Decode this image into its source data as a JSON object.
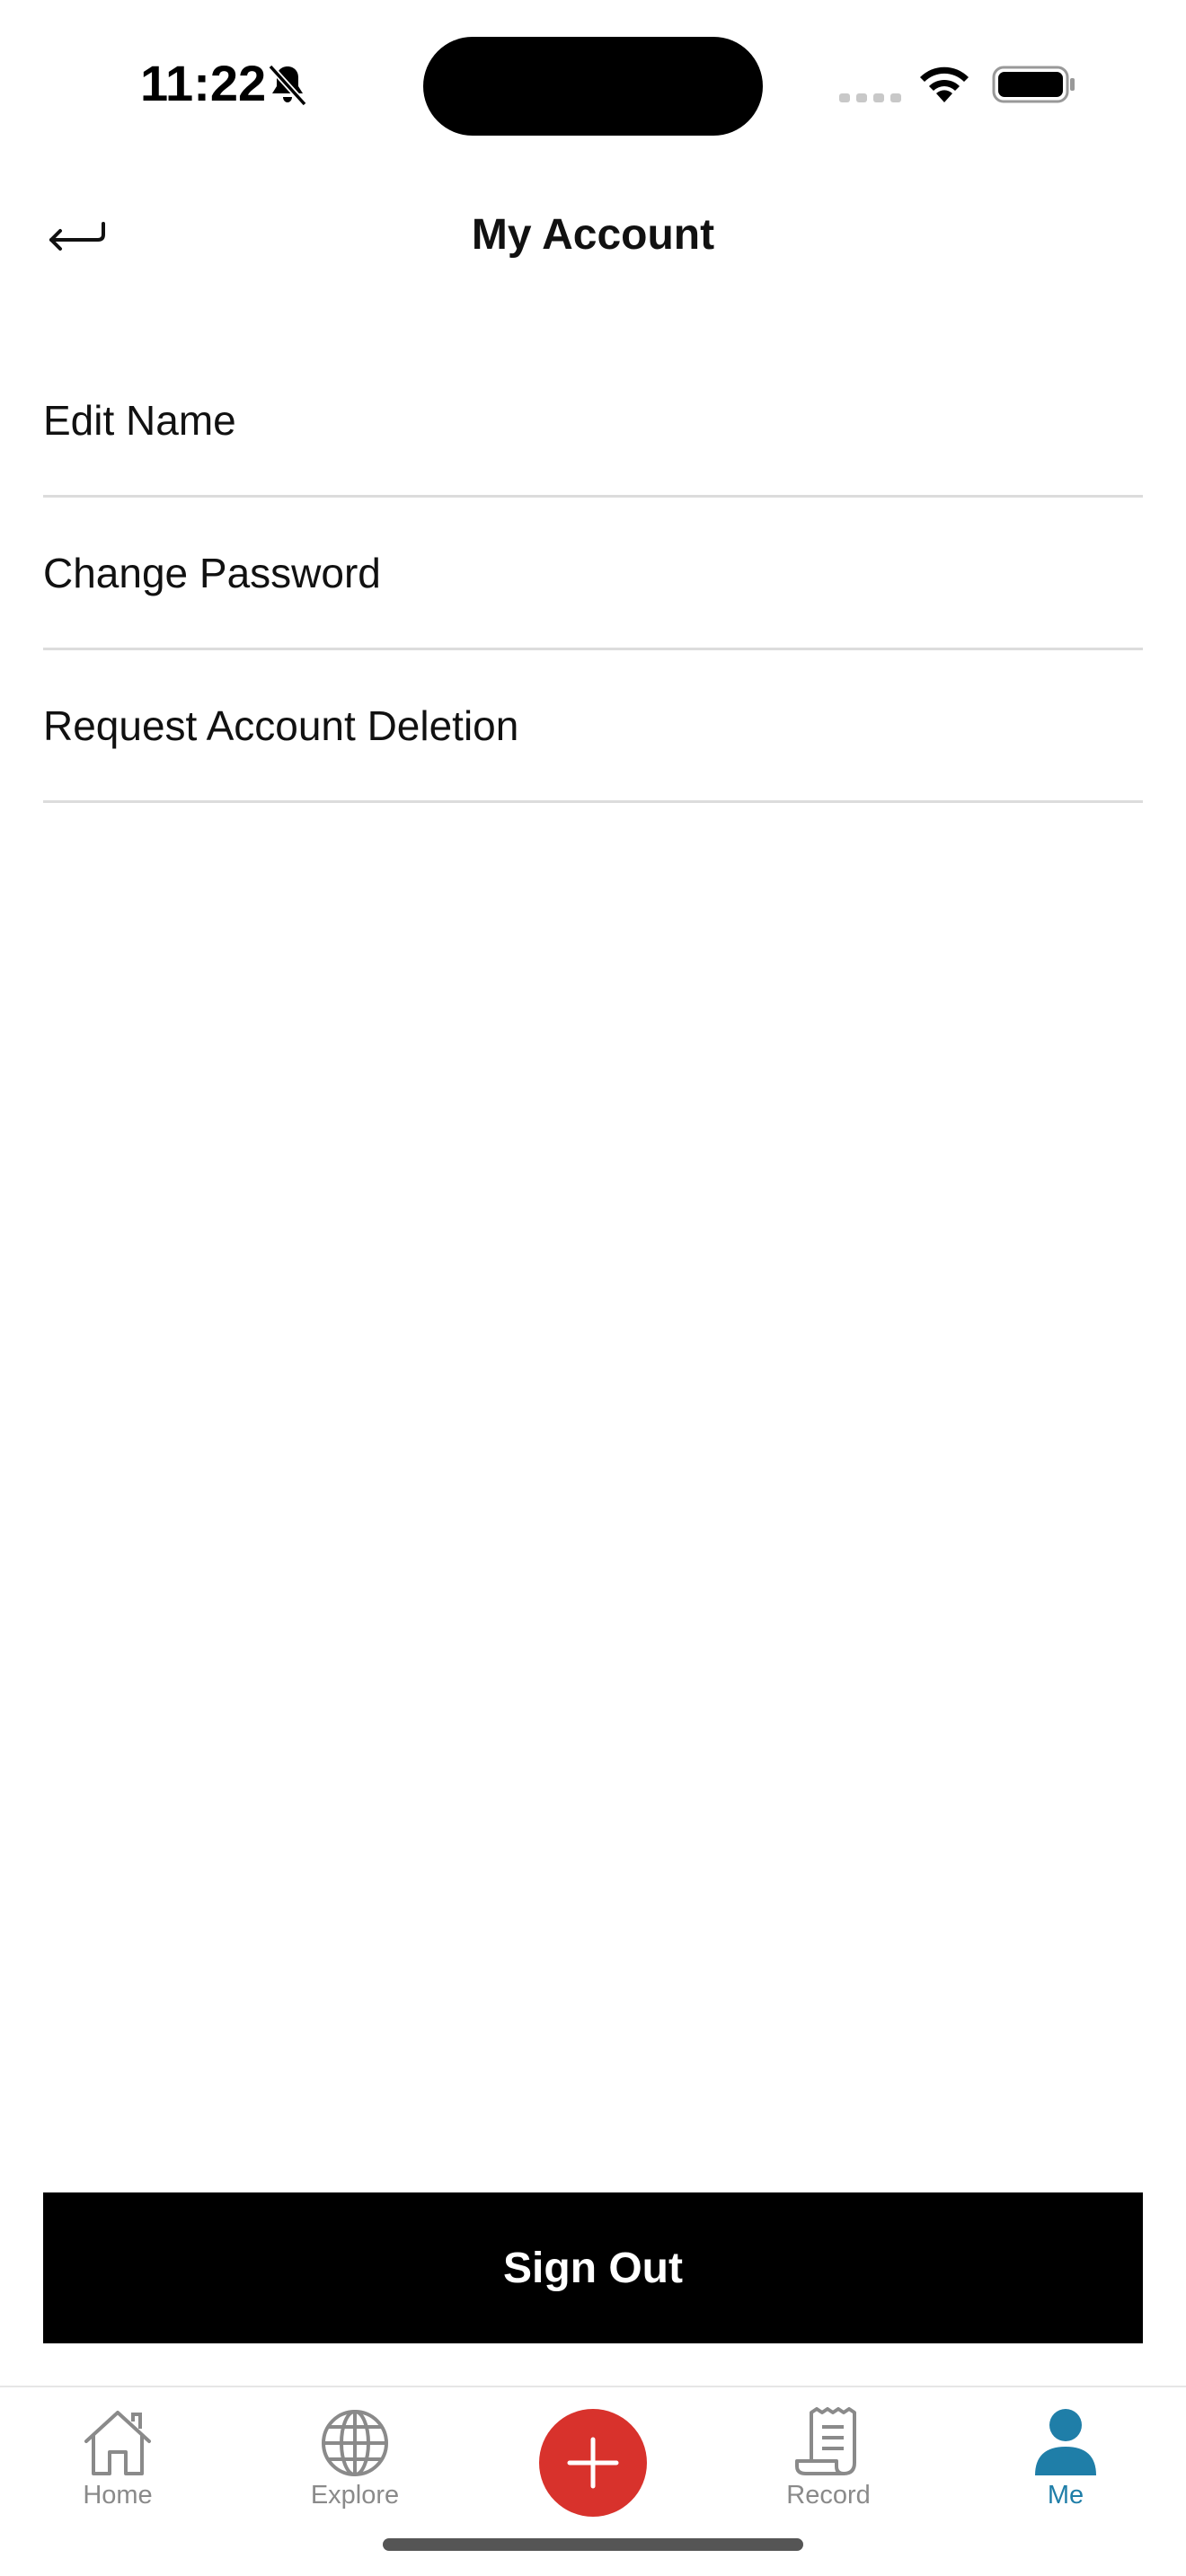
{
  "status_bar": {
    "time": "11:22"
  },
  "header": {
    "title": "My Account"
  },
  "menu": {
    "items": [
      {
        "label": "Edit Name"
      },
      {
        "label": "Change Password"
      },
      {
        "label": "Request Account Deletion"
      }
    ]
  },
  "sign_out": {
    "label": "Sign Out"
  },
  "tab_bar": {
    "tabs": [
      {
        "label": "Home",
        "icon": "home-icon"
      },
      {
        "label": "Explore",
        "icon": "globe-icon"
      },
      {
        "label": "",
        "icon": "plus-icon"
      },
      {
        "label": "Record",
        "icon": "receipt-icon"
      },
      {
        "label": "Me",
        "icon": "person-icon",
        "active": true
      }
    ],
    "active_color": "#1f7ea8",
    "inactive_color": "#8a8a8a",
    "add_color": "#d8322c"
  }
}
